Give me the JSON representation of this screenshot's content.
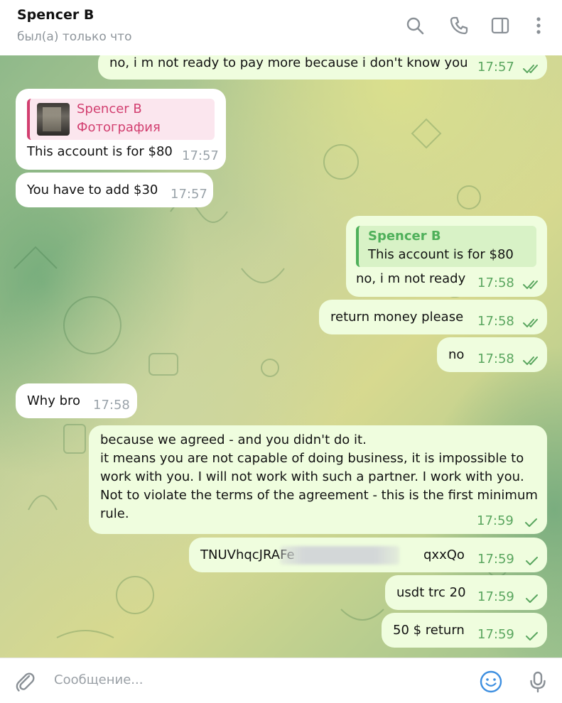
{
  "header": {
    "title": "Spencer B",
    "status": "был(а) только что",
    "icons": [
      "search-icon",
      "phone-icon",
      "sidebar-icon",
      "more-icon"
    ]
  },
  "messages": [
    {
      "dir": "out",
      "text": "no, i m not ready to pay more because i don't know you",
      "time": "17:57",
      "status": "read"
    },
    {
      "dir": "in",
      "reply_to": {
        "name": "Spencer B",
        "preview": "Фотография"
      },
      "text": "This account is for $80",
      "time": "17:57"
    },
    {
      "dir": "in",
      "text": "You have to add $30",
      "time": "17:57"
    },
    {
      "dir": "out",
      "reply_to": {
        "name": "Spencer B",
        "preview": "This account is for $80"
      },
      "text": "no, i m not ready",
      "time": "17:58",
      "status": "read"
    },
    {
      "dir": "out",
      "text": "return money please",
      "time": "17:58",
      "status": "read"
    },
    {
      "dir": "out",
      "text": "no",
      "time": "17:58",
      "status": "read"
    },
    {
      "dir": "in",
      "text": "Why bro",
      "time": "17:58"
    },
    {
      "dir": "out",
      "text": "because we agreed - and you didn't do it.\nit means you are not capable of doing business, it is impossible to work with you. I will not work with such a partner. I work with you. Not to violate the terms of the agreement - this is the first minimum rule.",
      "time": "17:59",
      "status": "sent"
    },
    {
      "dir": "out",
      "text_start": "TNUVhqcJRAFe",
      "text_end": "qxxQo",
      "time": "17:59",
      "status": "sent"
    },
    {
      "dir": "out",
      "text": "usdt trc 20",
      "time": "17:59",
      "status": "sent"
    },
    {
      "dir": "out",
      "text": "50 $ return",
      "time": "17:59",
      "status": "sent"
    }
  ],
  "composer": {
    "placeholder": "Сообщение...",
    "icons": [
      "attach-icon",
      "emoji-icon",
      "microphone-icon"
    ]
  },
  "colors": {
    "incoming_bubble": "#ffffff",
    "outgoing_bubble": "#effdde",
    "outgoing_time": "#5aa65f",
    "incoming_time": "#9aa3aa",
    "reply_incoming_accent": "#d23f70",
    "reply_outgoing_accent": "#4fb05a",
    "emoji_icon": "#3e8fe0"
  }
}
